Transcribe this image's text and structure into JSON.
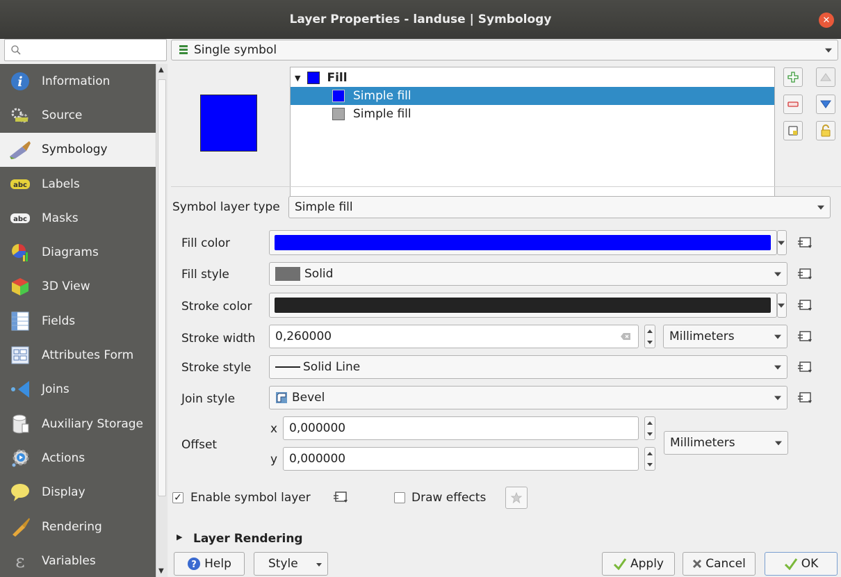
{
  "window": {
    "title": "Layer Properties - landuse | Symbology",
    "close_glyph": "✕"
  },
  "sidebar": {
    "search_placeholder": "",
    "items": [
      {
        "label": "Information",
        "icon": "info-icon",
        "active": false
      },
      {
        "label": "Source",
        "icon": "source-icon",
        "active": false
      },
      {
        "label": "Symbology",
        "icon": "brush-icon",
        "active": true
      },
      {
        "label": "Labels",
        "icon": "labels-icon",
        "active": false
      },
      {
        "label": "Masks",
        "icon": "masks-icon",
        "active": false
      },
      {
        "label": "Diagrams",
        "icon": "diagrams-icon",
        "active": false
      },
      {
        "label": "3D View",
        "icon": "3d-view-icon",
        "active": false
      },
      {
        "label": "Fields",
        "icon": "fields-icon",
        "active": false
      },
      {
        "label": "Attributes Form",
        "icon": "attributes-form-icon",
        "active": false
      },
      {
        "label": "Joins",
        "icon": "joins-icon",
        "active": false
      },
      {
        "label": "Auxiliary Storage",
        "icon": "auxiliary-storage-icon",
        "active": false
      },
      {
        "label": "Actions",
        "icon": "actions-icon",
        "active": false
      },
      {
        "label": "Display",
        "icon": "display-icon",
        "active": false
      },
      {
        "label": "Rendering",
        "icon": "rendering-icon",
        "active": false
      },
      {
        "label": "Variables",
        "icon": "variables-icon",
        "active": false
      }
    ]
  },
  "renderer": {
    "selected": "Single symbol"
  },
  "symbol_tree": {
    "root": "Fill",
    "layers": [
      "Simple fill",
      "Simple fill"
    ],
    "selected_index": 0
  },
  "colors": {
    "fill": "#0000ff",
    "stroke": "#232323",
    "fill_style_swatch": "#707070",
    "layer2_swatch": "#a8a8a8",
    "selection": "#308cc6"
  },
  "symbol_layer": {
    "type_label": "Symbol layer type",
    "type_value": "Simple fill",
    "fill_color_label": "Fill color",
    "fill_style_label": "Fill style",
    "fill_style_value": "Solid",
    "stroke_color_label": "Stroke color",
    "stroke_width_label": "Stroke width",
    "stroke_width_value": "0,260000",
    "stroke_width_unit": "Millimeters",
    "stroke_style_label": "Stroke style",
    "stroke_style_value": "Solid Line",
    "join_style_label": "Join style",
    "join_style_value": "Bevel",
    "offset_label": "Offset",
    "offset_x_label": "x",
    "offset_x_value": "0,000000",
    "offset_y_label": "y",
    "offset_y_value": "0,000000",
    "offset_unit": "Millimeters"
  },
  "options": {
    "enable_layer_label": "Enable symbol layer",
    "enable_layer_checked": true,
    "draw_effects_label": "Draw effects",
    "draw_effects_checked": false,
    "layer_rendering_label": "Layer Rendering"
  },
  "buttons": {
    "help": "Help",
    "style": "Style",
    "apply": "Apply",
    "cancel": "Cancel",
    "ok": "OK"
  }
}
